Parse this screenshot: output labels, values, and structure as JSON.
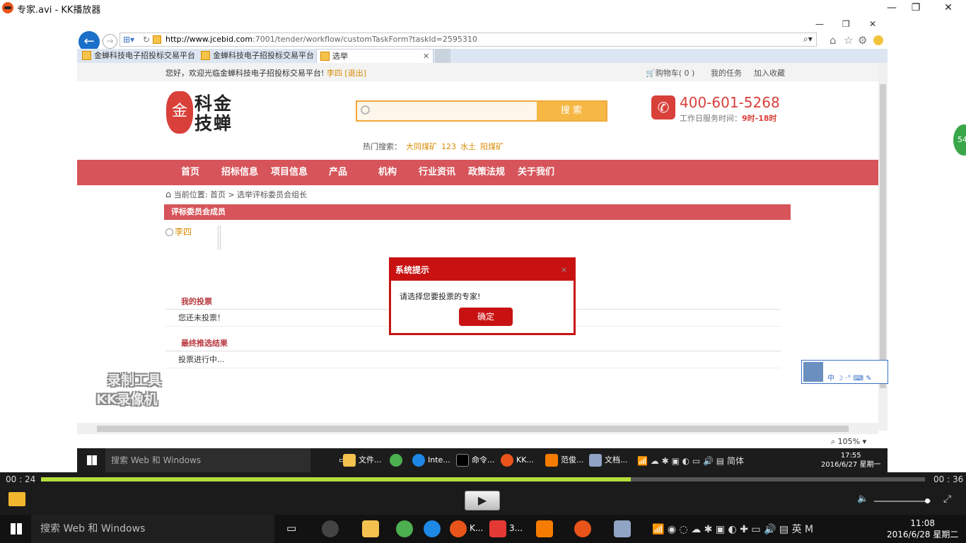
{
  "player": {
    "title": "专家.avi - KK播放器",
    "minimize": "—",
    "maximize": "❐",
    "close": "✕",
    "time_current": "00 : 24",
    "time_total": "00 : 36",
    "progress": 0.667
  },
  "browser": {
    "url_host": "http://www.jcebid.com",
    "url_path": ":7001/tender/workflow/customTaskForm?taskId=2595310",
    "tabs": [
      {
        "label": "金蝉科技电子招投标交易平台"
      },
      {
        "label": "金蝉科技电子招投标交易平台"
      },
      {
        "label": "选举"
      }
    ],
    "zoom": "105%"
  },
  "site": {
    "welcome": "您好，欢迎光临金蝉科技电子招投标交易平台!",
    "user": "李四 [退出]",
    "cart": "购物车( 0 )",
    "my_tasks": "我的任务",
    "add_fav": "加入收藏",
    "logo_seal": "金",
    "logo_text_1": "科金",
    "logo_text_2": "技蝉",
    "search_button": "搜 索",
    "hot_label": "热门搜索：",
    "hot_terms": [
      "大同煤矿",
      "123",
      "水土",
      "阳煤矿"
    ],
    "phone": "400-601-5268",
    "hours_label": "工作日服务时间：",
    "hours_value": "9时-18时",
    "nav": [
      "首页",
      "招标信息",
      "项目信息",
      "产品",
      "机构",
      "行业资讯",
      "政策法规",
      "关于我们"
    ],
    "breadcrumb": "当前位置: 首页 > 选举评标委员会组长",
    "panel_title": "评标委员会成员",
    "candidate": "李四",
    "my_votes_title": "我的投票",
    "my_votes_body": "您还未投票！",
    "result_title": "最终推选结果",
    "result_body": "投票进行中..."
  },
  "modal": {
    "title": "系统提示",
    "close": "×",
    "message": "请选择您要投票的专家!",
    "ok": "确定"
  },
  "watermark": {
    "line1": "录制工具",
    "line2": "KK录像机"
  },
  "inner_taskbar": {
    "search": "搜索 Web 和 Windows",
    "apps": [
      "文件...",
      "",
      "Inte...",
      "命令...",
      "KK...",
      "范俊...",
      "文档..."
    ],
    "ime": "简体",
    "time": "17:55",
    "date": "2016/6/27 星期一"
  },
  "outer_taskbar": {
    "search": "搜索 Web 和 Windows",
    "apps": [
      "K...",
      "3..."
    ],
    "ime": "英",
    "time": "11:08",
    "date": "2016/6/28 星期二"
  },
  "bubble": "54",
  "colors": {
    "brand_red": "#d6545a",
    "modal_red": "#c81212",
    "accent_orange": "#f6b845",
    "progress_green": "#b5dd3a"
  }
}
